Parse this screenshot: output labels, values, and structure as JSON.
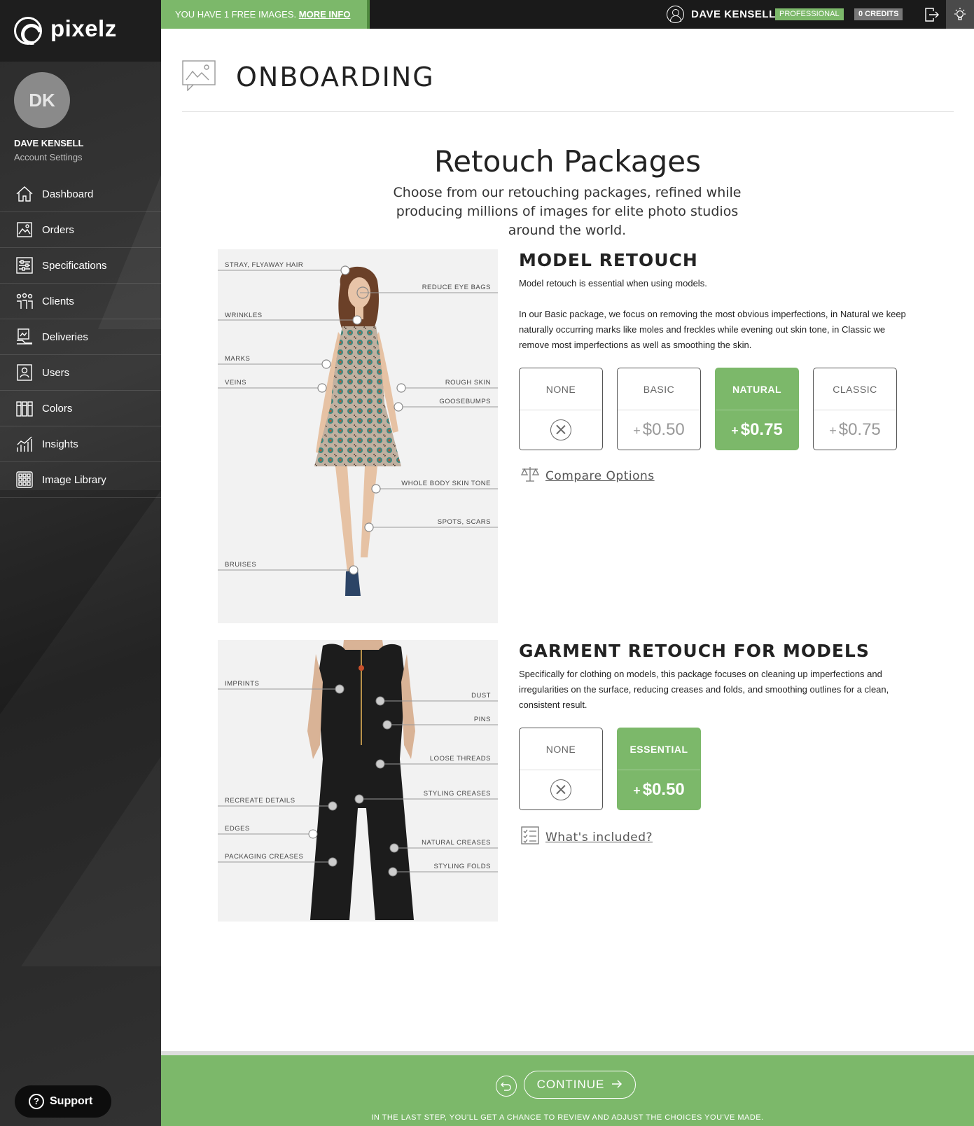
{
  "app": {
    "logo_text": "pixelz"
  },
  "topbar": {
    "free_banner_text": "YOU HAVE 1 FREE IMAGES.",
    "free_banner_link": "MORE INFO",
    "user_name": "DAVE KENSELL",
    "plan_badge": "PROFESSIONAL",
    "credits_badge": "0 CREDITS"
  },
  "sidebar": {
    "avatar_initials": "DK",
    "user_name": "DAVE KENSELL",
    "account_settings": "Account Settings",
    "items": [
      {
        "label": "Dashboard",
        "icon": "home-icon"
      },
      {
        "label": "Orders",
        "icon": "image-stack-icon"
      },
      {
        "label": "Specifications",
        "icon": "sliders-icon"
      },
      {
        "label": "Clients",
        "icon": "people-icon"
      },
      {
        "label": "Deliveries",
        "icon": "delivery-icon"
      },
      {
        "label": "Users",
        "icon": "user-card-icon"
      },
      {
        "label": "Colors",
        "icon": "color-swatches-icon"
      },
      {
        "label": "Insights",
        "icon": "bar-chart-icon"
      },
      {
        "label": "Image Library",
        "icon": "grid-icon"
      }
    ],
    "support_label": "Support"
  },
  "page": {
    "title": "ONBOARDING",
    "section_title": "Retouch Packages",
    "section_subtitle": "Choose from our retouching packages, refined while producing millions of images for elite photo studios around the world."
  },
  "model_retouch": {
    "title": "MODEL RETOUCH",
    "desc1": "Model retouch is essential when using models.",
    "desc2": "In our Basic package, we focus on removing the most obvious imperfections, in Natural we keep naturally occurring marks like moles and freckles while evening out skin tone, in Classic we remove most imperfections as well as smoothing the skin.",
    "options": [
      {
        "name": "NONE",
        "price": "",
        "selected": false
      },
      {
        "name": "BASIC",
        "price": "$0.50",
        "selected": false
      },
      {
        "name": "NATURAL",
        "price": "$0.75",
        "selected": true
      },
      {
        "name": "CLASSIC",
        "price": "$0.75",
        "selected": false
      }
    ],
    "link": "Compare Options",
    "callouts_left": [
      "STRAY, FLYAWAY HAIR",
      "WRINKLES",
      "MARKS",
      "VEINS",
      "BRUISES"
    ],
    "callouts_right": [
      "REDUCE EYE BAGS",
      "ROUGH SKIN",
      "GOOSEBUMPS",
      "WHOLE BODY SKIN TONE",
      "SPOTS, SCARS"
    ]
  },
  "garment_retouch": {
    "title": "GARMENT RETOUCH FOR MODELS",
    "desc": "Specifically for clothing on models, this package focuses on cleaning up imperfections and irregularities on the surface, reducing creases and folds, and smoothing outlines for a clean, consistent result.",
    "options": [
      {
        "name": "NONE",
        "price": "",
        "selected": false
      },
      {
        "name": "ESSENTIAL",
        "price": "$0.50",
        "selected": true
      }
    ],
    "link": "What's included?",
    "callouts_left": [
      "IMPRINTS",
      "RECREATE DETAILS",
      "EDGES",
      "PACKAGING CREASES"
    ],
    "callouts_right": [
      "DUST",
      "PINS",
      "LOOSE THREADS",
      "STYLING CREASES",
      "NATURAL CREASES",
      "STYLING FOLDS"
    ]
  },
  "footer": {
    "continue_label": "CONTINUE",
    "note": "IN THE LAST STEP, YOU'LL GET A CHANCE TO REVIEW AND ADJUST THE CHOICES YOU'VE MADE."
  },
  "colors": {
    "accent_green": "#7cb86a",
    "sidebar_dark": "#2b2b2b"
  }
}
